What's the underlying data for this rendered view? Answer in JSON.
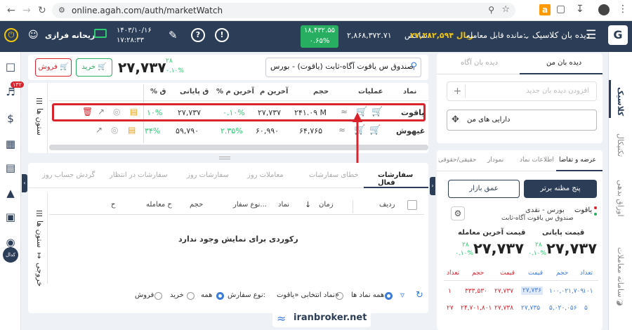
{
  "browser": {
    "url": "online.agah.com/auth/marketWatch"
  },
  "header": {
    "watch_title": "دیده بان کلاسیک",
    "remaining_label": "مانده قابل معامله: ",
    "remaining_value": "۲۷,۲۸۲,۵۹۴ ریال",
    "index_label": "شاخص: ",
    "index_value": "۲,۸۶۸,۳۷۲.۷۱",
    "index_change": "۱۸,۴۳۲.۵۵",
    "index_percent": "۰.۶۵%",
    "date": "۱۴۰۳/۱۰/۱۶",
    "time": "۱۷:۲۸:۳۳",
    "user": "ریحانه فرازی"
  },
  "order_bar": {
    "search_value": "صندوق س یاقوت آگاه-ثابت (یاقوت) - بورس",
    "buy": "خرید",
    "sell": "فروش",
    "price": "۲۷,۷۳۷",
    "change": "۲۸",
    "change_pct": "۰.۱۰%"
  },
  "watch_table": {
    "side_label": "ستون ها",
    "headers": [
      "نماد",
      "عملیات",
      "حجم",
      "آخرین م",
      "% آخرین م",
      "ق پایانی",
      "% ق"
    ],
    "rows": [
      {
        "symbol": "یاقوت",
        "volume": "۲۴۱.۰۹ M",
        "last": "۲۷,۷۳۷",
        "last_pct": "۰.۱۰%",
        "close": "۲۷,۷۳۷",
        "close_pct": "۱۰%"
      },
      {
        "symbol": "غیهوش",
        "volume": "۶۴,۷۶۵",
        "last": "۶۰,۹۹۰",
        "last_pct": "۲.۳۵%",
        "close": "۵۹,۷۹۰",
        "close_pct": "۳۴%"
      }
    ]
  },
  "orders": {
    "tabs": [
      "سفارشات فعال",
      "خطای سفارشات",
      "معاملات روز",
      "سفارشات روز",
      "سفارشات در انتظار",
      "گردش حساب روز"
    ],
    "headers": [
      "ردیف",
      "زمان",
      "نماد",
      "نوع سفار...",
      "حجم",
      "ح معامله",
      "ح"
    ],
    "empty": "رکوردی برای نمایش وجود ندارد",
    "side_cols": "ستون ها",
    "side_export": "خروجی",
    "filter_all": "همه نماد ها",
    "filter_selected": "نماد انتخابی «یاقوت»",
    "type_label": "نوع سفارش:",
    "type_all": "همه",
    "type_buy": "خرید",
    "type_sell": "فروش"
  },
  "watchlist": {
    "tab_mine": "دیده بان من",
    "tab_agah": "دیده بان آگاه",
    "new_placeholder": "افزودن دیده بان جدید",
    "my_assets": "دارایی های من"
  },
  "quote": {
    "tabs": [
      "عرضه و تقاضا",
      "اطلاعات نماد",
      "نمودار",
      "حقیقی/حقوقی"
    ],
    "btn_best5": "پنج مظنه برتر",
    "btn_depth": "عمق بازار",
    "symbol": "یاقوت",
    "market": "بورس - نقدی",
    "full_name": "صندوق س یاقوت آگاه-ثابت",
    "close_label": "قیمت پایانی",
    "last_label": "قیمت آخرین معامله",
    "close_value": "۲۷,۷۳۷",
    "last_value": "۲۷,۷۳۷",
    "close_chg": "۲۸",
    "close_pct": "۰.۱۰%",
    "last_chg": "۲۸",
    "last_pct": "۰.۱۰%",
    "book_headers": [
      "تعداد",
      "حجم",
      "قیمت",
      "قیمت",
      "حجم",
      "تعداد"
    ],
    "book_rows": [
      [
        "۱۰۱",
        "۱۰۰,۰۲۱,۷۰۹",
        "۲۷,۷۳۶",
        "۲۷,۷۳۷",
        "۳۳۳,۵۳۰",
        "۱"
      ],
      [
        "۵",
        "۵,۰۲۰,۰۵۶",
        "۲۷,۷۳۵",
        "۲۷,۷۳۸",
        "۲۴,۷۰۱,۸۰۱",
        "۲۷"
      ]
    ]
  },
  "right_rail": [
    "کلاسیک",
    "تکنیکال",
    "اوراق بدهی",
    "سامانه معاملات"
  ],
  "left_rail_badge": "۱۳۲",
  "watermark": "iranbroker.net"
}
